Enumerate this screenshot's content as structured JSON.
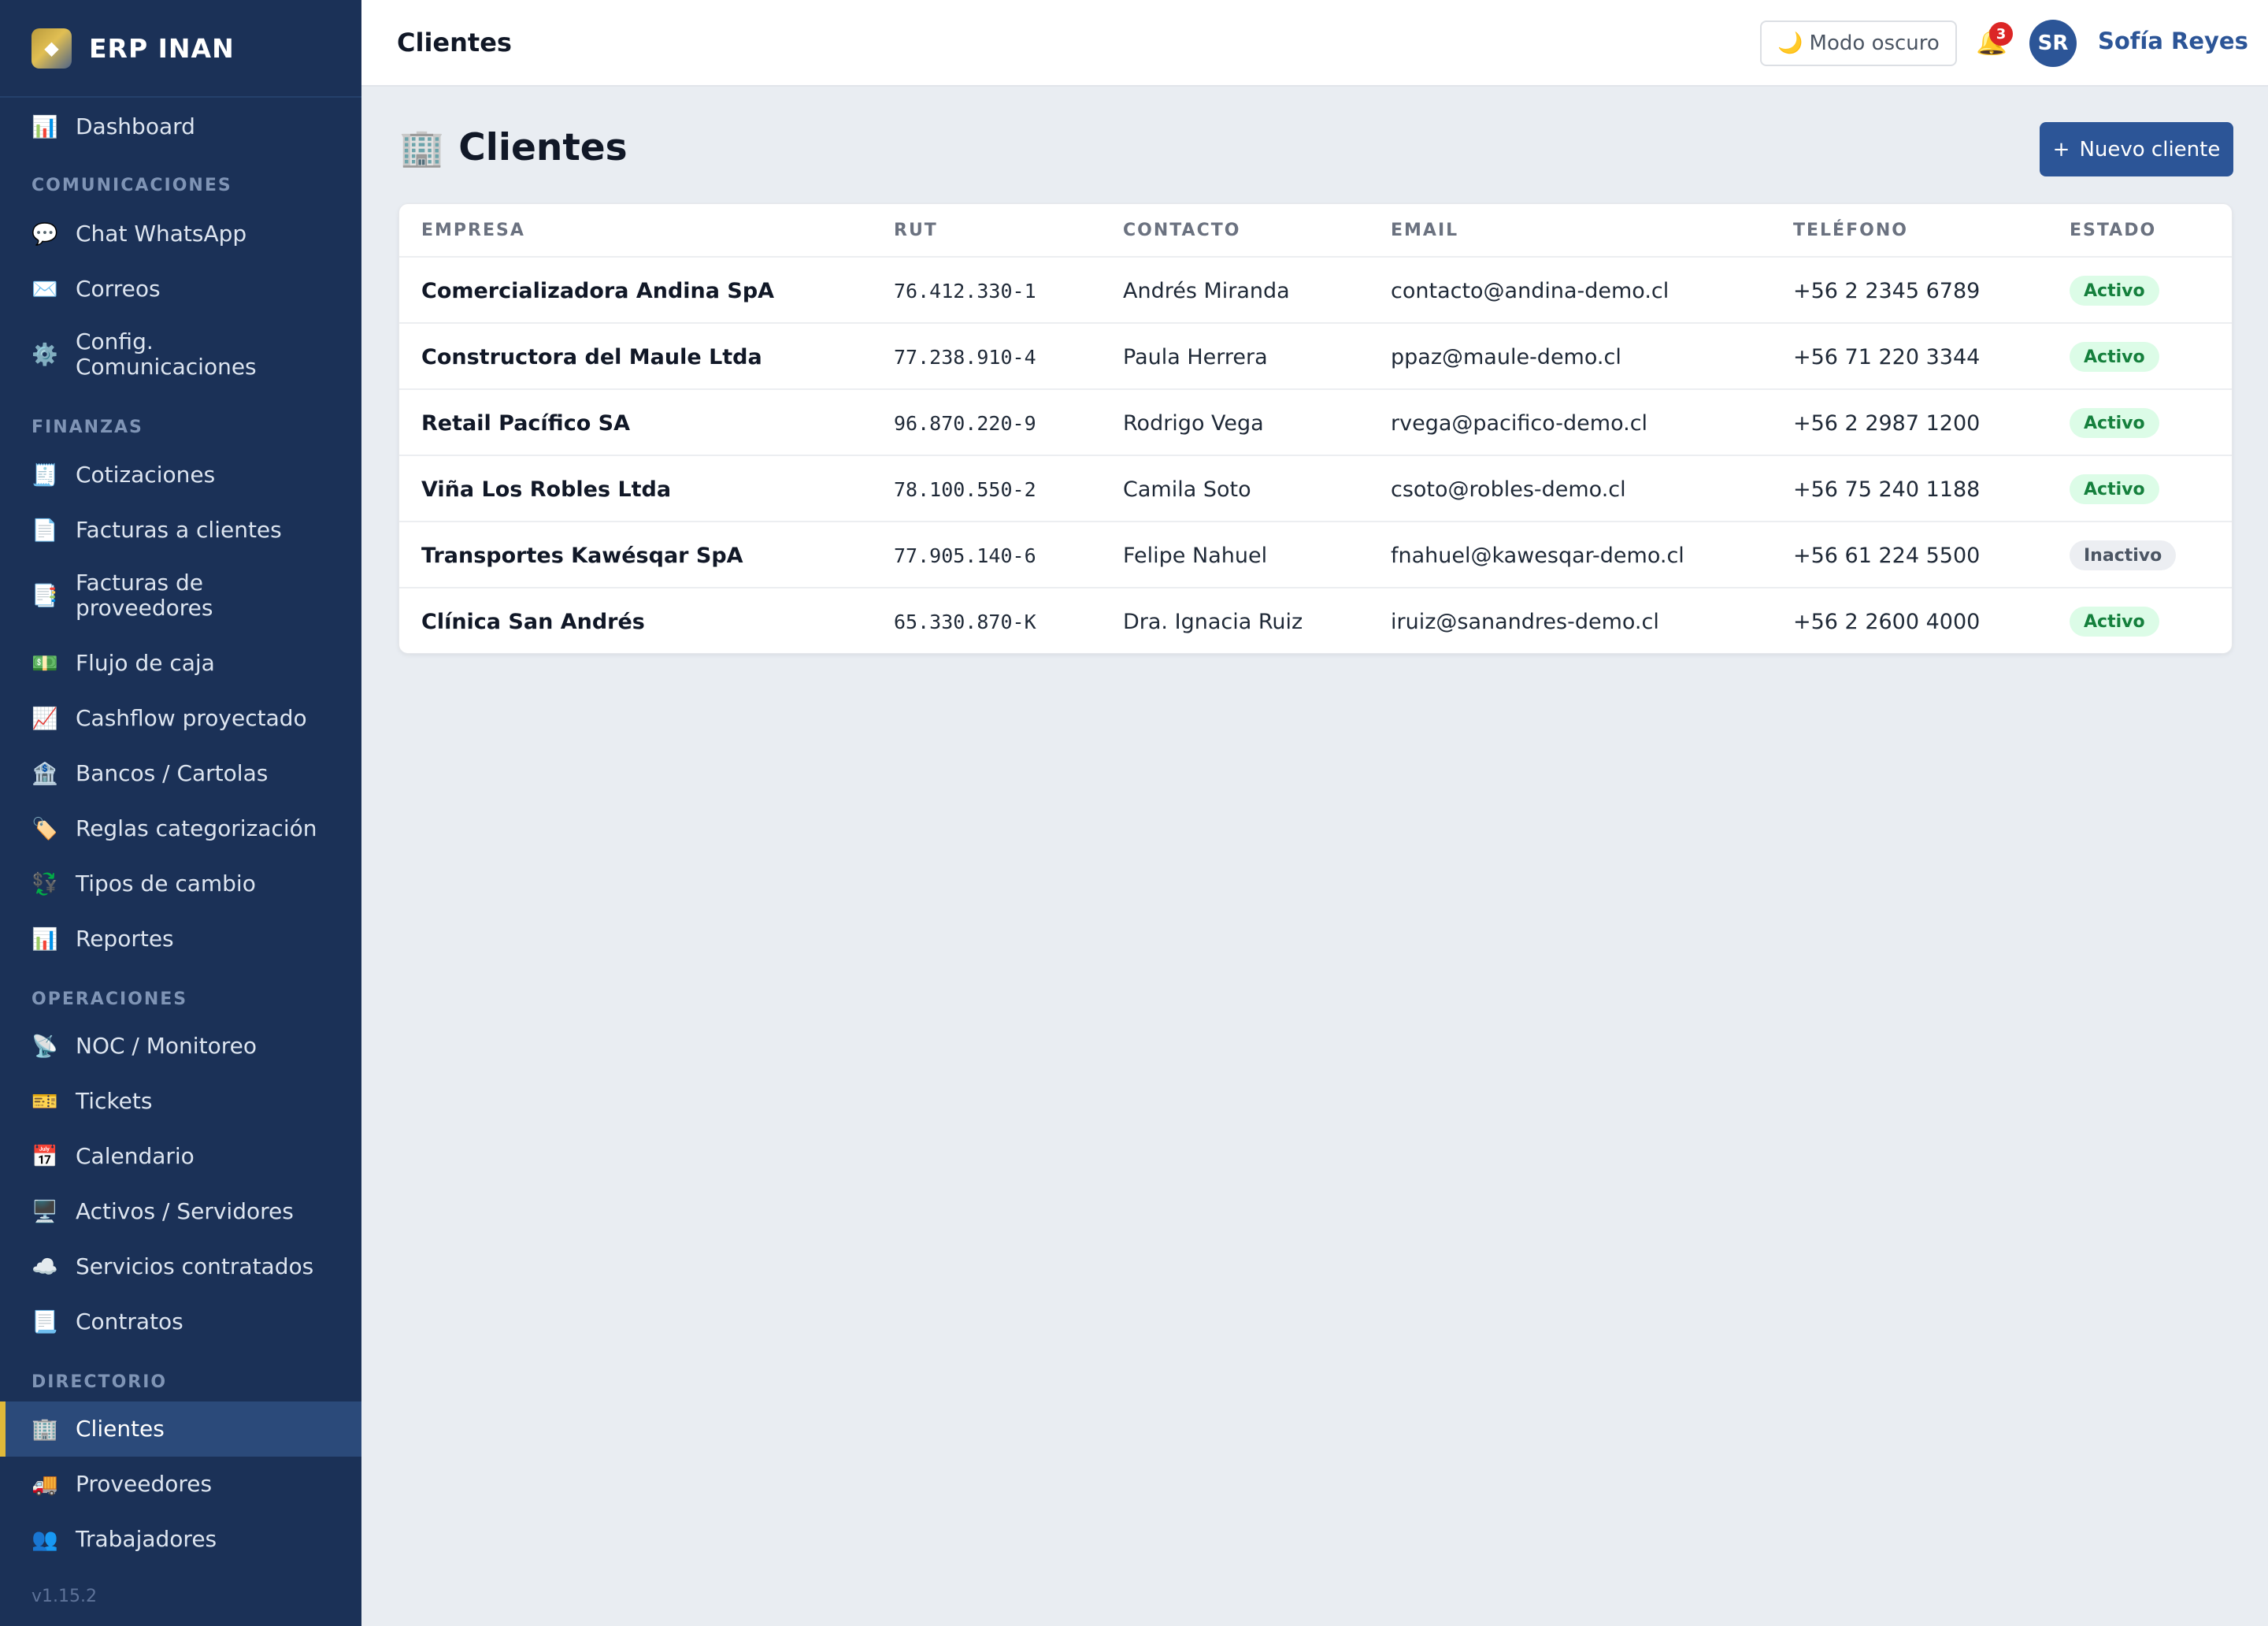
{
  "app": {
    "name": "ERP INAN",
    "version": "v1.15.2"
  },
  "sidebar": {
    "sections": [
      "COMUNICACIONES",
      "FINANZAS",
      "OPERACIONES",
      "DIRECTORIO"
    ],
    "items": [
      {
        "icon": "bar-chart-icon",
        "glyph": "📊",
        "label": "Dashboard"
      },
      {
        "icon": "chat-icon",
        "glyph": "💬",
        "label": "Chat WhatsApp"
      },
      {
        "icon": "envelope-icon",
        "glyph": "✉️",
        "label": "Correos"
      },
      {
        "icon": "gear-icon",
        "glyph": "⚙️",
        "label": "Config. Comunicaciones"
      },
      {
        "icon": "receipt-icon",
        "glyph": "🧾",
        "label": "Cotizaciones"
      },
      {
        "icon": "document-icon",
        "glyph": "📄",
        "label": "Facturas a clientes"
      },
      {
        "icon": "invoice-icon",
        "glyph": "📑",
        "label": "Facturas de proveedores"
      },
      {
        "icon": "money-icon",
        "glyph": "💵",
        "label": "Flujo de caja"
      },
      {
        "icon": "trend-chart-icon",
        "glyph": "📈",
        "label": "Cashflow proyectado"
      },
      {
        "icon": "bank-icon",
        "glyph": "🏦",
        "label": "Bancos / Cartolas"
      },
      {
        "icon": "tag-icon",
        "glyph": "🏷️",
        "label": "Reglas categorización"
      },
      {
        "icon": "currency-exchange-icon",
        "glyph": "💱",
        "label": "Tipos de cambio"
      },
      {
        "icon": "report-chart-icon",
        "glyph": "📊",
        "label": "Reportes"
      },
      {
        "icon": "satellite-icon",
        "glyph": "📡",
        "label": "NOC / Monitoreo"
      },
      {
        "icon": "ticket-icon",
        "glyph": "🎫",
        "label": "Tickets"
      },
      {
        "icon": "calendar-icon",
        "glyph": "📅",
        "label": "Calendario"
      },
      {
        "icon": "monitor-icon",
        "glyph": "🖥️",
        "label": "Activos / Servidores"
      },
      {
        "icon": "cloud-icon",
        "glyph": "☁️",
        "label": "Servicios contratados"
      },
      {
        "icon": "contract-icon",
        "glyph": "📃",
        "label": "Contratos"
      },
      {
        "icon": "office-building-icon",
        "glyph": "🏢",
        "label": "Clientes"
      },
      {
        "icon": "truck-icon",
        "glyph": "🚚",
        "label": "Proveedores"
      },
      {
        "icon": "people-icon",
        "glyph": "👥",
        "label": "Trabajadores"
      }
    ]
  },
  "topbar": {
    "title": "Clientes",
    "dark_mode_label": "Modo oscuro",
    "dark_mode_glyph": "🌙",
    "bell_glyph": "🔔",
    "notifications_count": "3",
    "user_initials": "SR",
    "user_name": "Sofía Reyes"
  },
  "page": {
    "title": "Clientes",
    "title_glyph": "🏢",
    "new_button_plus": "+",
    "new_button_label": "Nuevo cliente"
  },
  "table": {
    "headers": [
      "EMPRESA",
      "RUT",
      "CONTACTO",
      "EMAIL",
      "TELÉFONO",
      "ESTADO"
    ],
    "rows": [
      {
        "empresa": "Comercializadora Andina SpA",
        "rut": "76.412.330-1",
        "contacto": "Andrés Miranda",
        "email": "contacto@andina-demo.cl",
        "telefono": "+56 2 2345 6789",
        "estado": "Activo"
      },
      {
        "empresa": "Constructora del Maule Ltda",
        "rut": "77.238.910-4",
        "contacto": "Paula Herrera",
        "email": "ppaz@maule-demo.cl",
        "telefono": "+56 71 220 3344",
        "estado": "Activo"
      },
      {
        "empresa": "Retail Pacífico SA",
        "rut": "96.870.220-9",
        "contacto": "Rodrigo Vega",
        "email": "rvega@pacifico-demo.cl",
        "telefono": "+56 2 2987 1200",
        "estado": "Activo"
      },
      {
        "empresa": "Viña Los Robles Ltda",
        "rut": "78.100.550-2",
        "contacto": "Camila Soto",
        "email": "csoto@robles-demo.cl",
        "telefono": "+56 75 240 1188",
        "estado": "Activo"
      },
      {
        "empresa": "Transportes Kawésqar SpA",
        "rut": "77.905.140-6",
        "contacto": "Felipe Nahuel",
        "email": "fnahuel@kawesqar-demo.cl",
        "telefono": "+56 61 224 5500",
        "estado": "Inactivo"
      },
      {
        "empresa": "Clínica San Andrés",
        "rut": "65.330.870-K",
        "contacto": "Dra. Ignacia Ruiz",
        "email": "iruiz@sanandres-demo.cl",
        "telefono": "+56 2 2600 4000",
        "estado": "Activo"
      }
    ]
  },
  "colors": {
    "sidebar_bg": "#1b3157",
    "accent": "#2c5597",
    "active_marker": "#e0b93a",
    "status_active": "#15803d",
    "status_inactive": "#4b5563"
  }
}
